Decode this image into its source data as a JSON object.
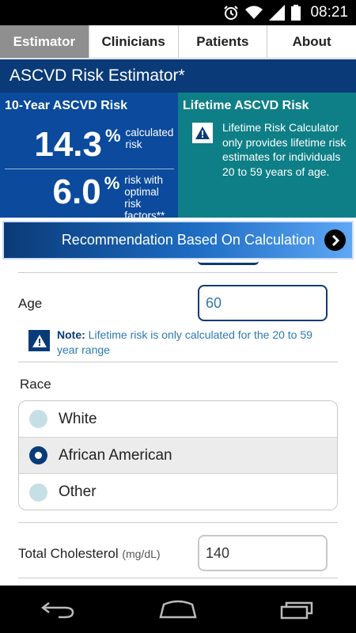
{
  "status": {
    "time": "08:21",
    "icons": [
      "alarm-icon",
      "wifi-icon",
      "signal-icon",
      "battery-icon"
    ]
  },
  "tabs": [
    {
      "label": "Estimator",
      "active": true
    },
    {
      "label": "Clinicians",
      "active": false
    },
    {
      "label": "Patients",
      "active": false
    },
    {
      "label": "About",
      "active": false
    }
  ],
  "title": "ASCVD Risk Estimator*",
  "risk10": {
    "header": "10-Year ASCVD Risk",
    "calculated_value": "14.3",
    "calculated_unit": "%",
    "calculated_label": "calculated risk",
    "optimal_value": "6.0",
    "optimal_unit": "%",
    "optimal_label": "risk with optimal risk factors**"
  },
  "lifetime": {
    "header": "Lifetime ASCVD Risk",
    "message": "Lifetime Risk Calculator only provides lifetime risk estimates for individuals 20 to 59 years of age."
  },
  "recommendation": {
    "label": "Recommendation Based On Calculation"
  },
  "form": {
    "age_label": "Age",
    "age_value": "60",
    "note_prefix": "Note:",
    "note_text": " Lifetime risk is only calculated for the 20 to 59 year range",
    "race_label": "Race",
    "race_options": [
      {
        "label": "White",
        "selected": false
      },
      {
        "label": "African American",
        "selected": true
      },
      {
        "label": "Other",
        "selected": false
      }
    ],
    "cholesterol_label": "Total Cholesterol",
    "cholesterol_unit": "(mg/dL)",
    "cholesterol_value": "140"
  },
  "colors": {
    "primary": "#0a3b78",
    "risk10_bg": "#0b4a9c",
    "lifetime_bg": "#0e7f86",
    "active_tab": "#8f8f8f",
    "note_text": "#2a7ab2"
  }
}
